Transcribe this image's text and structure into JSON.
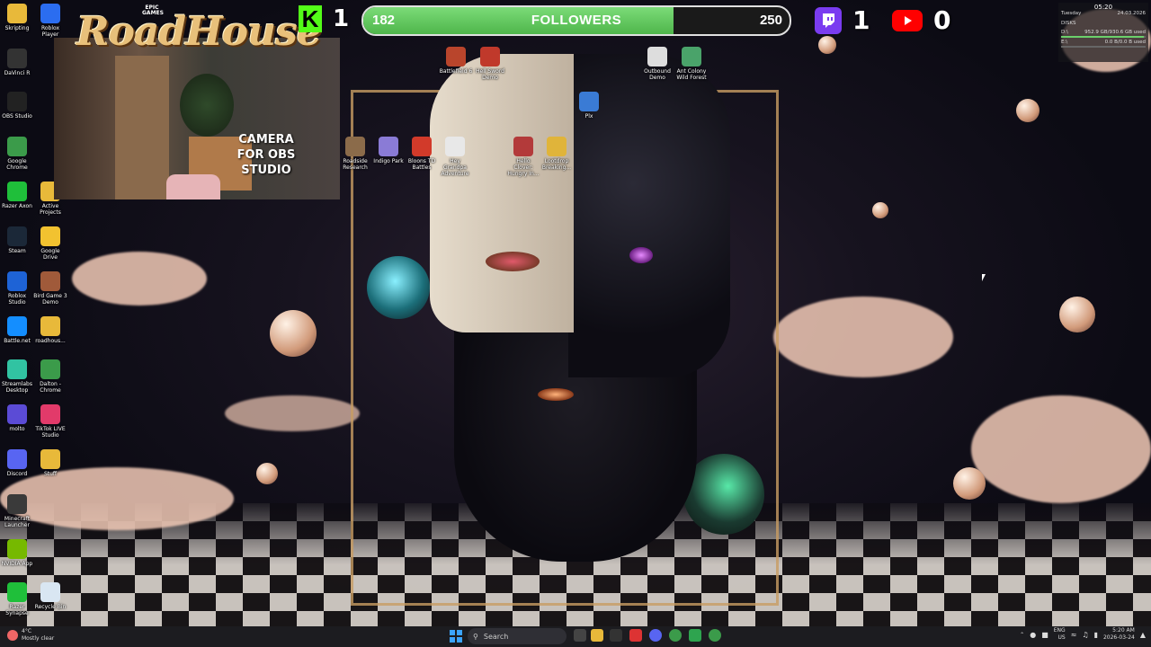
{
  "overlay": {
    "epic_badge": "EPIC GAMES",
    "game_logo": "RoadHouse",
    "camera_label": "CAMERA FOR OBS STUDIO",
    "kick_count": "1",
    "followers": {
      "current": "182",
      "label": "FOLLOWERS",
      "goal": "250",
      "progress": 0.728
    },
    "twitch_count": "1",
    "youtube_count": "0"
  },
  "system_widget": {
    "time": "05:20",
    "day": "Tuesday",
    "date": "24.03.2026",
    "section": "DISKS",
    "disks": [
      {
        "name": "D:\\",
        "value": "952.9 GB/930.6 GB used",
        "usage": 0.98
      },
      {
        "name": "E:\\",
        "value": "0.0 B/0.0 B used",
        "usage": 0.0
      }
    ]
  },
  "desktop_icons_left": [
    {
      "label": "Skripting",
      "icon": "folder-icon",
      "color": "#e8b93a"
    },
    {
      "label": "Roblox Player",
      "icon": "roblox-icon",
      "color": "#2b6df0"
    },
    {
      "label": "DaVinci R",
      "icon": "davinci-icon",
      "color": "#333333"
    },
    {
      "label": "OBS Studio",
      "icon": "obs-icon",
      "color": "#222222"
    },
    {
      "label": "Google Chrome",
      "icon": "chrome-icon",
      "color": "#3b9b4a"
    },
    {
      "label": "Razer Axon",
      "icon": "razer-icon",
      "color": "#1fbf3a"
    },
    {
      "label": "Active Projects",
      "icon": "folder-icon",
      "color": "#e8b93a"
    },
    {
      "label": "Steam",
      "icon": "steam-icon",
      "color": "#1b2838"
    },
    {
      "label": "Google Drive",
      "icon": "drive-icon",
      "color": "#f2c230"
    },
    {
      "label": "Roblox Studio",
      "icon": "roblox-studio-icon",
      "color": "#1e63d6"
    },
    {
      "label": "Bird Game 3 Demo",
      "icon": "bird-game-icon",
      "color": "#a05a3a"
    },
    {
      "label": "Battle.net",
      "icon": "battlenet-icon",
      "color": "#148eff"
    },
    {
      "label": "roadhous...",
      "icon": "folder-icon",
      "color": "#e8b93a"
    },
    {
      "label": "Streamlabs Desktop",
      "icon": "streamlabs-icon",
      "color": "#31c3a2"
    },
    {
      "label": "Dalton - Chrome",
      "icon": "chrome-icon",
      "color": "#3b9b4a"
    },
    {
      "label": "molto",
      "icon": "app-icon",
      "color": "#5b4bd6"
    },
    {
      "label": "TikTok LIVE Studio",
      "icon": "tiktok-icon",
      "color": "#e23a6a"
    },
    {
      "label": "Discord",
      "icon": "discord-icon",
      "color": "#5865f2"
    },
    {
      "label": "Stuff",
      "icon": "folder-icon",
      "color": "#e8b93a"
    },
    {
      "label": "Minecraft Launcher",
      "icon": "minecraft-icon",
      "color": "#3a3a3a"
    },
    {
      "label": "NVIDIA App",
      "icon": "nvidia-icon",
      "color": "#76b900"
    },
    {
      "label": "Razer Synapse",
      "icon": "razer-icon",
      "color": "#1fbf3a"
    },
    {
      "label": "Recycle Bin",
      "icon": "recycle-bin-icon",
      "color": "#d9e6f2"
    }
  ],
  "desktop_icons_top": [
    {
      "label": "Battlefield 6",
      "icon": "battlefield-icon",
      "color": "#b9452c"
    },
    {
      "label": "Hell Sword Demo",
      "icon": "hellsword-icon",
      "color": "#c0392b"
    },
    {
      "label": "Outbound Demo",
      "icon": "outbound-icon",
      "color": "#dddddd"
    },
    {
      "label": "Ant Colony Wild Forest",
      "icon": "antcolony-icon",
      "color": "#4aa36a"
    },
    {
      "label": "Plx",
      "icon": "plx-icon",
      "color": "#3a7bd5"
    }
  ],
  "desktop_icons_middle": [
    {
      "label": "Roadside Research",
      "icon": "roadside-icon",
      "color": "#8b6b4a"
    },
    {
      "label": "Indigo Park",
      "icon": "indigo-icon",
      "color": "#8a7bd6"
    },
    {
      "label": "Bloons TD Battles",
      "icon": "bloons-icon",
      "color": "#d23a2a"
    },
    {
      "label": "Hey Grandpa Adventure",
      "icon": "grandpa-icon",
      "color": "#e8e8e8"
    },
    {
      "label": "Hello Clover: Hungry In...",
      "icon": "clover-icon",
      "color": "#b33a3a"
    },
    {
      "label": "Lootdrop Breaking...",
      "icon": "lootdrop-icon",
      "color": "#e0b43a"
    }
  ],
  "taskbar": {
    "weather_temp": "4°C",
    "weather_desc": "Mostly clear",
    "search_placeholder": "Search",
    "language_line1": "ENG",
    "language_line2": "US",
    "time": "5:20 AM",
    "date": "2026-03-24"
  }
}
